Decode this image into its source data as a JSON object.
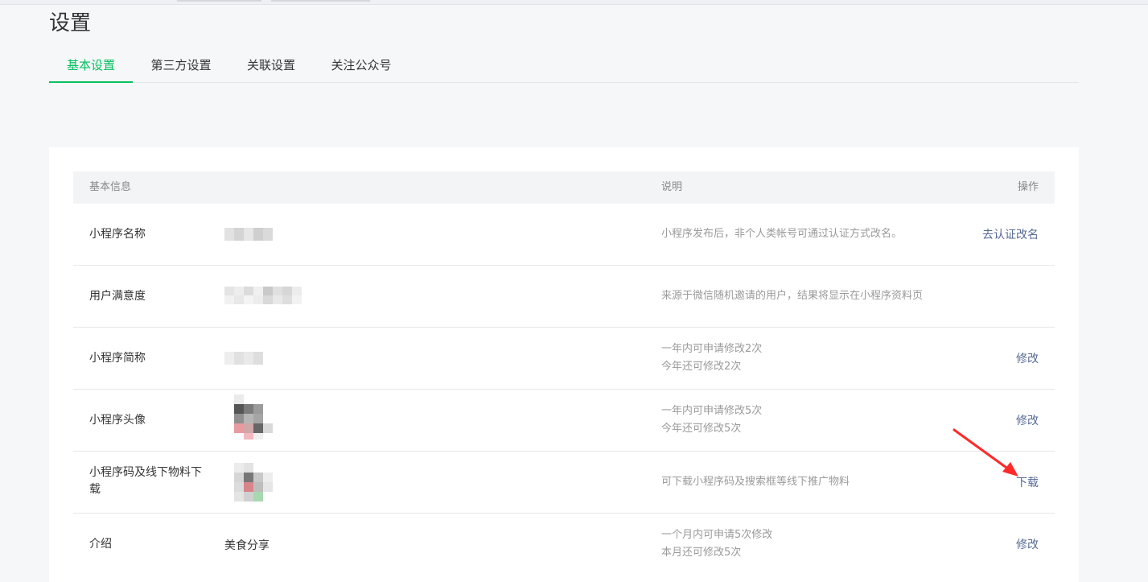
{
  "page": {
    "title": "设置"
  },
  "tabs": [
    {
      "label": "基本设置",
      "active": true
    },
    {
      "label": "第三方设置",
      "active": false
    },
    {
      "label": "关联设置",
      "active": false
    },
    {
      "label": "关注公众号",
      "active": false
    }
  ],
  "table": {
    "headers": {
      "info": "基本信息",
      "desc": "说明",
      "op": "操作"
    },
    "rows": [
      {
        "label": "小程序名称",
        "value": "",
        "desc": [
          "小程序发布后，非个人类帐号可通过认证方式改名。"
        ],
        "action": "去认证改名"
      },
      {
        "label": "用户满意度",
        "value": "",
        "desc": [
          "来源于微信随机邀请的用户，结果将显示在小程序资料页"
        ],
        "action": ""
      },
      {
        "label": "小程序简称",
        "value": "",
        "desc": [
          "一年内可申请修改2次",
          "今年还可修改2次"
        ],
        "action": "修改"
      },
      {
        "label": "小程序头像",
        "value": "",
        "desc": [
          "一年内可申请修改5次",
          "今年还可修改5次"
        ],
        "action": "修改"
      },
      {
        "label": "小程序码及线下物料下载",
        "value": "",
        "desc": [
          "可下载小程序码及搜索框等线下推广物料"
        ],
        "action": "下载"
      },
      {
        "label": "介绍",
        "value": "美食分享",
        "desc": [
          "一个月内可申请5次修改",
          "本月还可修改5次"
        ],
        "action": "修改"
      }
    ]
  },
  "colors": {
    "accent": "#07c160",
    "link": "#576b95",
    "annotation_arrow": "#ff2a2a"
  }
}
